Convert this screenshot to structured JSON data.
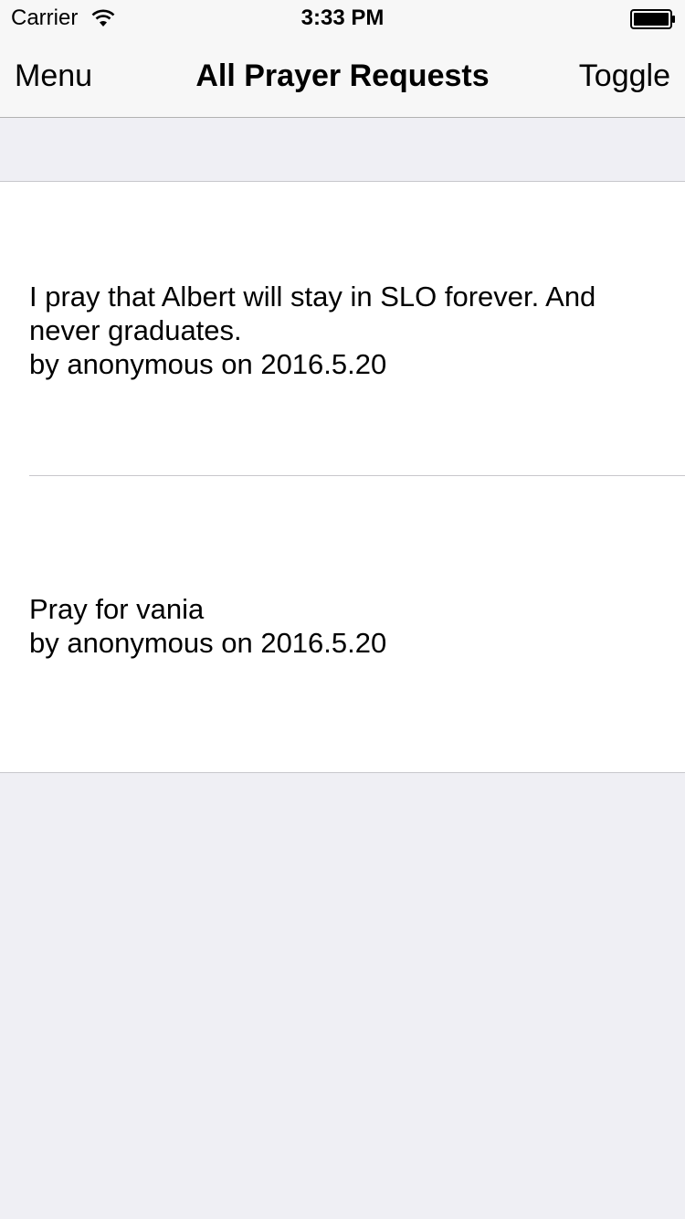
{
  "status_bar": {
    "carrier": "Carrier",
    "time": "3:33 PM"
  },
  "nav": {
    "left_label": "Menu",
    "title": "All Prayer Requests",
    "right_label": "Toggle"
  },
  "requests": [
    {
      "text": "I pray that Albert will stay in SLO forever. And never graduates.",
      "byline": "by anonymous on 2016.5.20"
    },
    {
      "text": "Pray for vania",
      "byline": "by anonymous on 2016.5.20"
    }
  ],
  "icons": {
    "wifi": "wifi-icon",
    "battery": "battery-icon"
  }
}
